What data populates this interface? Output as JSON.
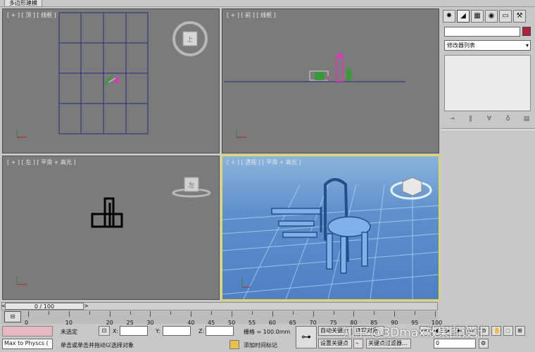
{
  "tab": {
    "title": "多边形建模"
  },
  "viewports": {
    "top": {
      "label": "[ + ] [ 顶 ] [ 线框 ]",
      "cube": "上"
    },
    "front": {
      "label": "[ + ] [ 前 ] [ 线框 ]"
    },
    "left": {
      "label": "[ + ] [ 左 ] [ 平滑 + 高光 ]",
      "cube": "左"
    },
    "persp": {
      "label": "[ + ] [ 透视 ] [ 平滑 + 高光 ]"
    }
  },
  "command_panel": {
    "modifier_list": "修改器列表",
    "tabs": [
      "create-icon",
      "modify-icon",
      "hierarchy-icon",
      "motion-icon",
      "display-icon",
      "utilities-icon"
    ],
    "color": "#b0203a"
  },
  "timeline": {
    "frame": "0 / 100",
    "ticks": [
      "0",
      "10",
      "20",
      "25",
      "30",
      "40",
      "45",
      "50",
      "55",
      "60",
      "65",
      "70",
      "75",
      "80",
      "85",
      "90",
      "95",
      "100"
    ]
  },
  "status": {
    "script_listener": "Max to Physcs (",
    "selection": "未选定",
    "x_label": "X:",
    "y_label": "Y:",
    "z_label": "Z:",
    "grid": "栅格 = 100.0mm",
    "auto_key": "自动关键点",
    "selected": "选定对象",
    "set_key": "设置关键点",
    "key_filters": "关键点过滤器...",
    "prompt": "单击或单击并拖动以选择对象",
    "add_time_tag": "添加时间标记",
    "frame_value": "0",
    "watermark": "知乎 @3Dmax效果图设计"
  }
}
